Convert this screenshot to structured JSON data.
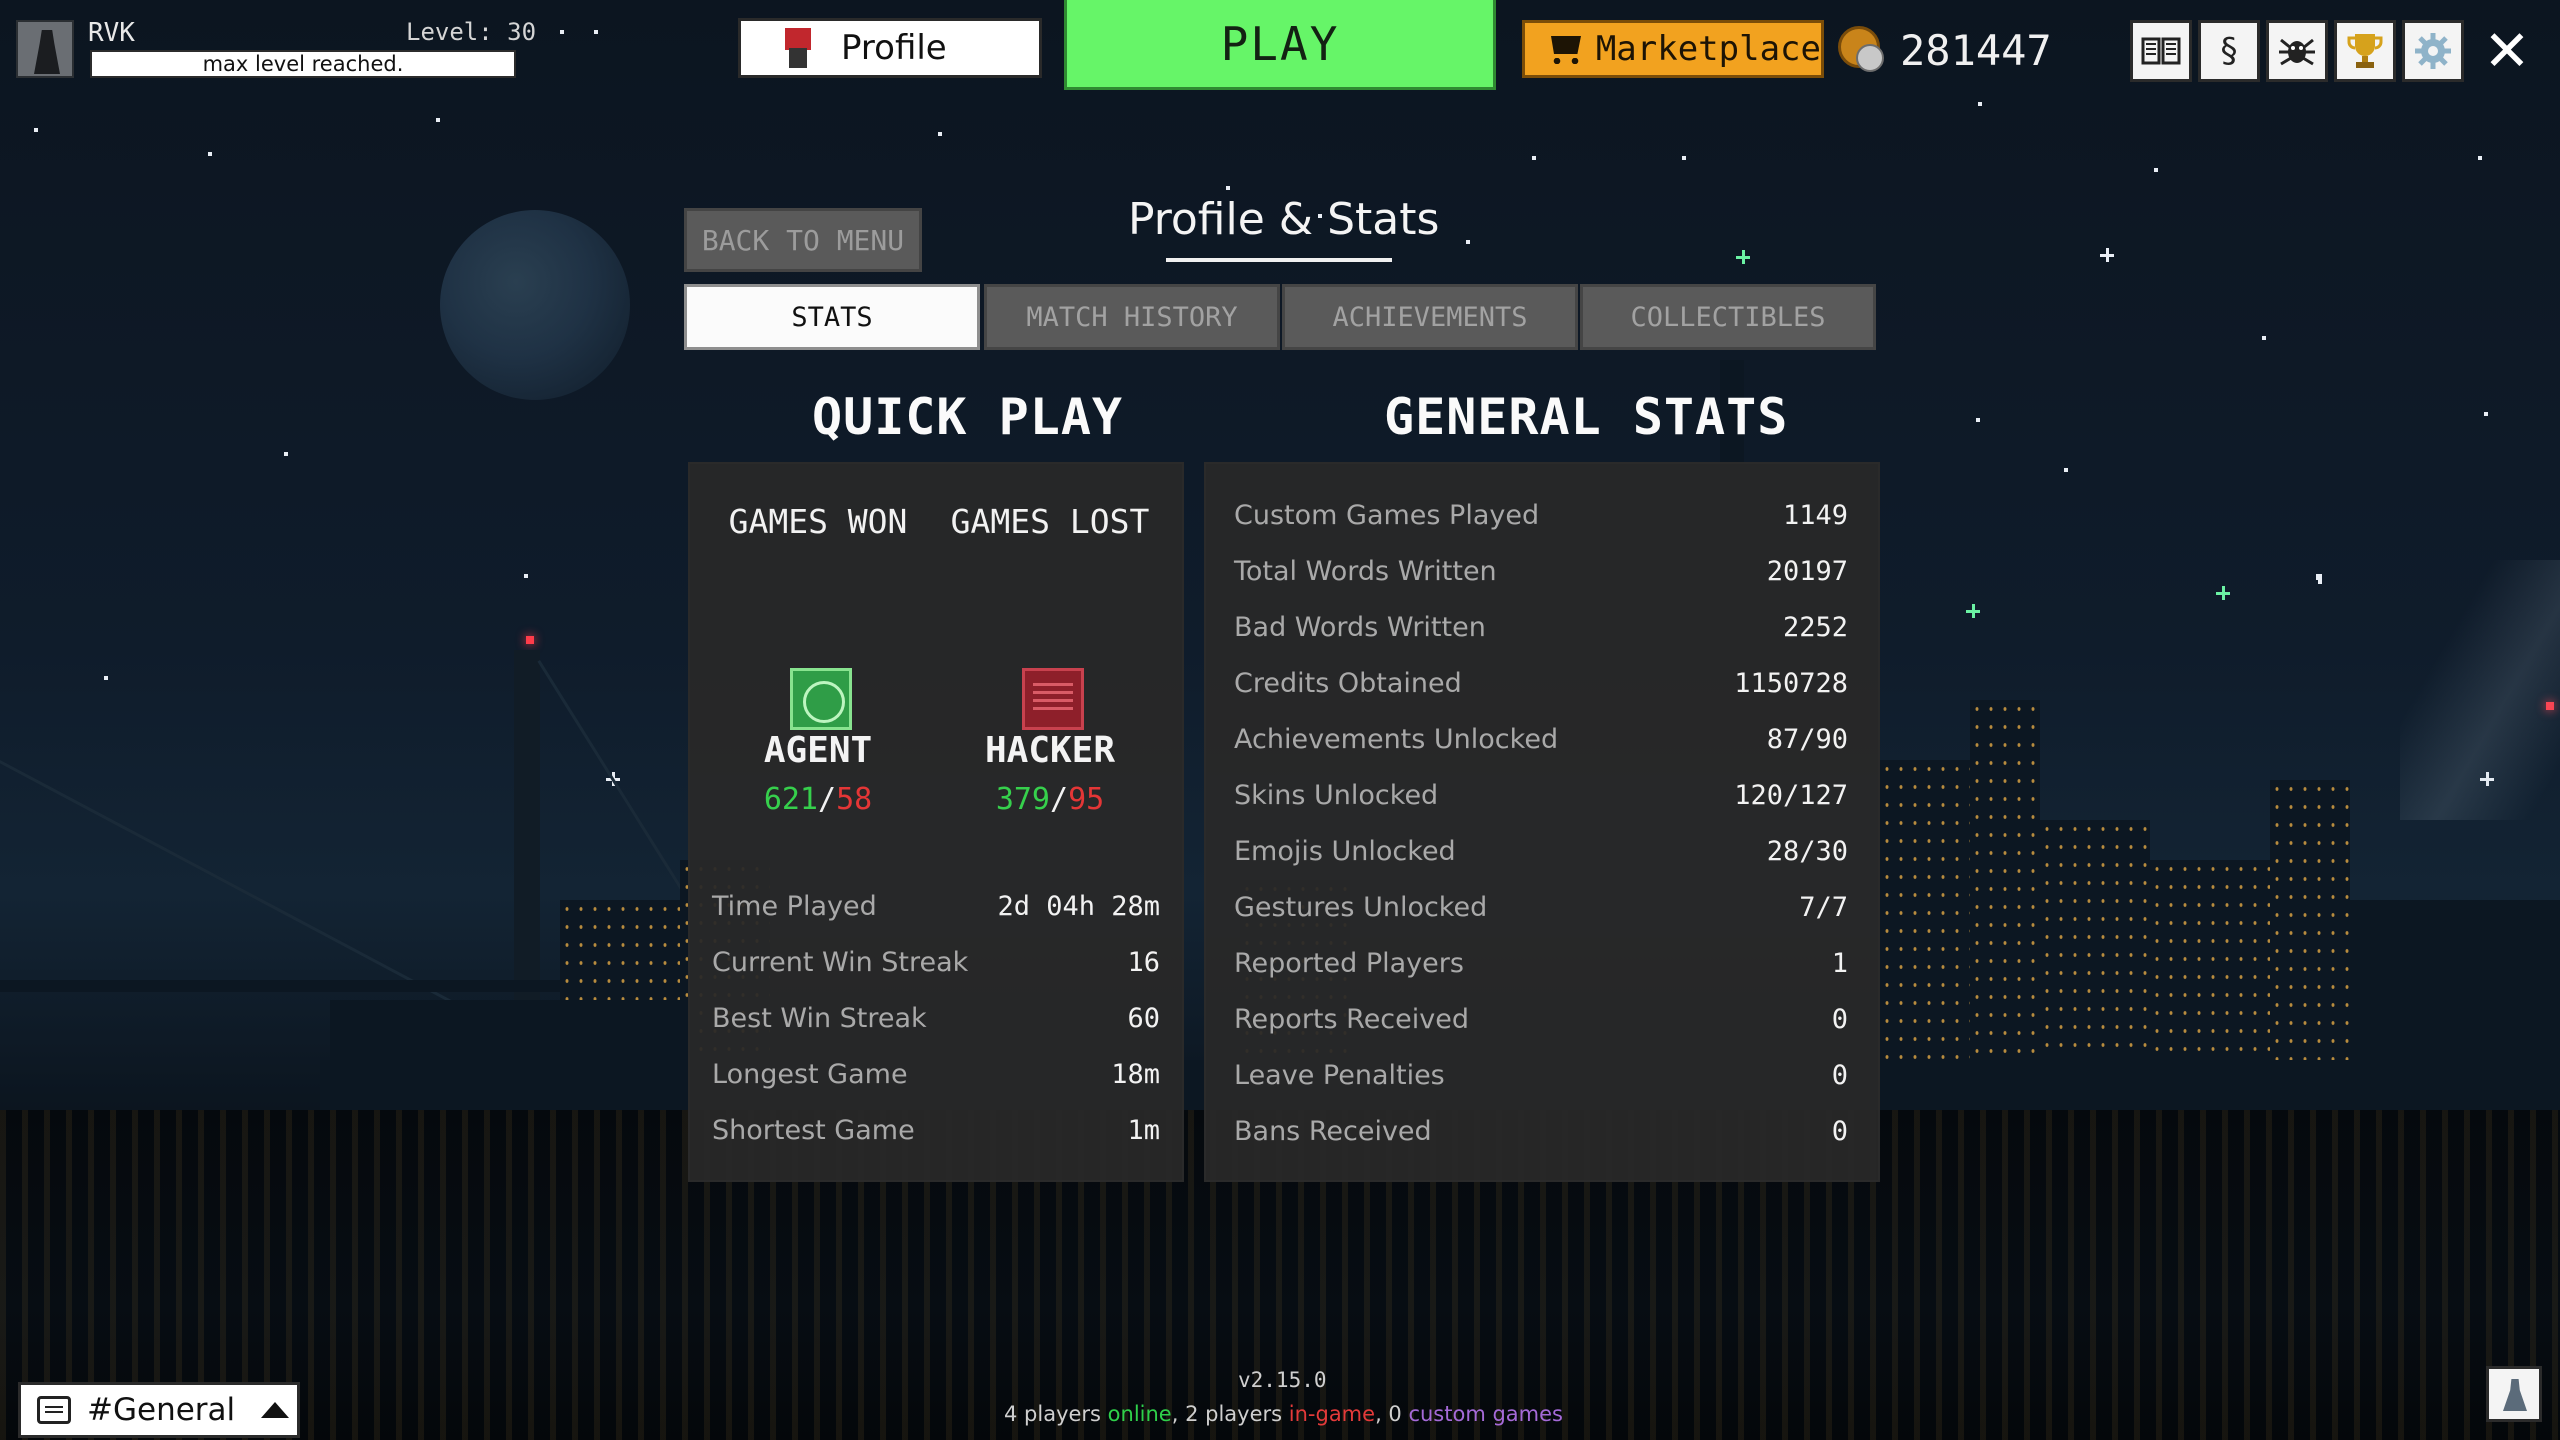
{
  "player": {
    "name": "RVK",
    "level_text": "Level: 30",
    "xp_text": "max level reached."
  },
  "nav": {
    "profile_label": "Profile",
    "play_label": "PLAY",
    "marketplace_label": "Marketplace",
    "credits": "281447",
    "icons": [
      "book-icon",
      "rules-icon",
      "bug-icon",
      "trophy-icon",
      "settings-icon",
      "close-icon"
    ]
  },
  "page": {
    "title": "Profile & Stats",
    "back_label": "BACK TO MENU",
    "tabs": [
      "STATS",
      "MATCH HISTORY",
      "ACHIEVEMENTS",
      "COLLECTIBLES"
    ],
    "active_tab": "STATS"
  },
  "quick_play": {
    "heading": "QUICK PLAY",
    "games_won_label": "GAMES WON",
    "games_lost_label": "GAMES LOST",
    "agent": {
      "name": "AGENT",
      "won": "621",
      "lost": "58"
    },
    "hacker": {
      "name": "HACKER",
      "won": "379",
      "lost": "95"
    },
    "stats": [
      {
        "label": "Time Played",
        "value": "2d 04h 28m"
      },
      {
        "label": "Current Win Streak",
        "value": "16"
      },
      {
        "label": "Best Win Streak",
        "value": "60"
      },
      {
        "label": "Longest Game",
        "value": "18m"
      },
      {
        "label": "Shortest Game",
        "value": "1m"
      }
    ]
  },
  "general_stats": {
    "heading": "GENERAL STATS",
    "rows": [
      {
        "label": "Custom Games Played",
        "value": "1149"
      },
      {
        "label": "Total Words Written",
        "value": "20197"
      },
      {
        "label": "Bad Words Written",
        "value": "2252"
      },
      {
        "label": "Credits Obtained",
        "value": "1150728"
      },
      {
        "label": "Achievements Unlocked",
        "value": "87/90"
      },
      {
        "label": "Skins Unlocked",
        "value": "120/127"
      },
      {
        "label": "Emojis Unlocked",
        "value": "28/30"
      },
      {
        "label": "Gestures Unlocked",
        "value": "7/7"
      },
      {
        "label": "Reported Players",
        "value": "1"
      },
      {
        "label": "Reports Received",
        "value": "0"
      },
      {
        "label": "Leave Penalties",
        "value": "0"
      },
      {
        "label": "Bans Received",
        "value": "0"
      }
    ]
  },
  "footer": {
    "version": "v2.15.0",
    "players_online_prefix": "4 players ",
    "online_word": "online",
    "mid1": ", 2 players ",
    "ingame_word": "in-game",
    "mid2": ", 0 ",
    "custom_word": "custom games"
  },
  "chat": {
    "channel": "#General"
  },
  "colors": {
    "play_green": "#66f568",
    "marketplace_orange": "#f2a21f",
    "win_green": "#36d04c",
    "loss_red": "#e43636"
  }
}
